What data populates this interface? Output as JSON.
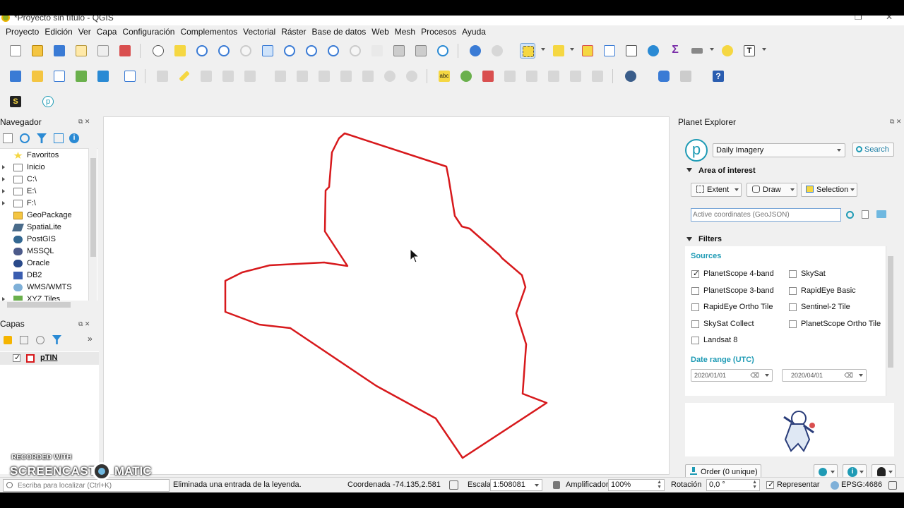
{
  "window": {
    "title": "*Proyecto sin título - QGIS"
  },
  "menu": [
    "Proyecto",
    "Edición",
    "Ver",
    "Capa",
    "Configuración",
    "Complementos",
    "Vectorial",
    "Ráster",
    "Base de datos",
    "Web",
    "Mesh",
    "Procesos",
    "Ayuda"
  ],
  "navigator": {
    "title": "Navegador",
    "items": [
      {
        "label": "Favoritos",
        "icon": "star-icon",
        "expandable": false
      },
      {
        "label": "Inicio",
        "icon": "folder-icon",
        "expandable": true
      },
      {
        "label": "C:\\",
        "icon": "folder-icon",
        "expandable": true
      },
      {
        "label": "E:\\",
        "icon": "folder-icon",
        "expandable": true
      },
      {
        "label": "F:\\",
        "icon": "folder-icon",
        "expandable": true
      },
      {
        "label": "GeoPackage",
        "icon": "geopackage-icon",
        "expandable": false
      },
      {
        "label": "SpatiaLite",
        "icon": "spatialite-icon",
        "expandable": false
      },
      {
        "label": "PostGIS",
        "icon": "postgis-icon",
        "expandable": false
      },
      {
        "label": "MSSQL",
        "icon": "mssql-icon",
        "expandable": false
      },
      {
        "label": "Oracle",
        "icon": "oracle-icon",
        "expandable": false
      },
      {
        "label": "DB2",
        "icon": "db2-icon",
        "expandable": false
      },
      {
        "label": "WMS/WMTS",
        "icon": "globe-icon",
        "expandable": false
      },
      {
        "label": "XYZ Tiles",
        "icon": "tiles-icon",
        "expandable": true
      }
    ]
  },
  "layers": {
    "title": "Capas",
    "items": [
      {
        "label": "pTIN",
        "checked": true,
        "color": "#d7191c"
      }
    ]
  },
  "map": {
    "polygon_color": "#d7191c"
  },
  "planet": {
    "title": "Planet Explorer",
    "imagery_select": "Daily Imagery",
    "search_label": "Search",
    "aoi_title": "Area of interest",
    "extent_label": "Extent",
    "draw_label": "Draw",
    "selection_label": "Selection",
    "coords_placeholder": "Active coordinates (GeoJSON)",
    "filters_title": "Filters",
    "sources_title": "Sources",
    "sources_left": [
      {
        "label": "PlanetScope 4-band",
        "checked": true
      },
      {
        "label": "PlanetScope 3-band",
        "checked": false
      },
      {
        "label": "RapidEye Ortho Tile",
        "checked": false
      },
      {
        "label": "SkySat Collect",
        "checked": false
      },
      {
        "label": "Landsat 8",
        "checked": false
      }
    ],
    "sources_right": [
      {
        "label": "SkySat",
        "checked": false
      },
      {
        "label": "RapidEye Basic",
        "checked": false
      },
      {
        "label": "Sentinel-2 Tile",
        "checked": false
      },
      {
        "label": "PlanetScope Ortho Tile",
        "checked": false
      }
    ],
    "date_range_title": "Date range (UTC)",
    "date_from": "2020/01/01",
    "date_to": "2020/04/01",
    "order_label": "Order (0 unique)",
    "accent_color": "#1f9bb5"
  },
  "status": {
    "locator_placeholder": "Escriba para localizar (Ctrl+K)",
    "message": "Eliminada una entrada de la leyenda.",
    "coord_label": "Coordenada",
    "coord_value": "-74.135,2.581",
    "scale_label": "Escala",
    "scale_value": "1:508081",
    "magnifier_label": "Amplificador",
    "magnifier_value": "100%",
    "rotation_label": "Rotación",
    "rotation_value": "0,0 °",
    "render_label": "Representar",
    "render_checked": true,
    "crs_label": "EPSG:4686"
  },
  "watermark": {
    "line1": "RECORDED WITH",
    "line2": "SCREENCAST",
    "line3": "MATIC"
  }
}
